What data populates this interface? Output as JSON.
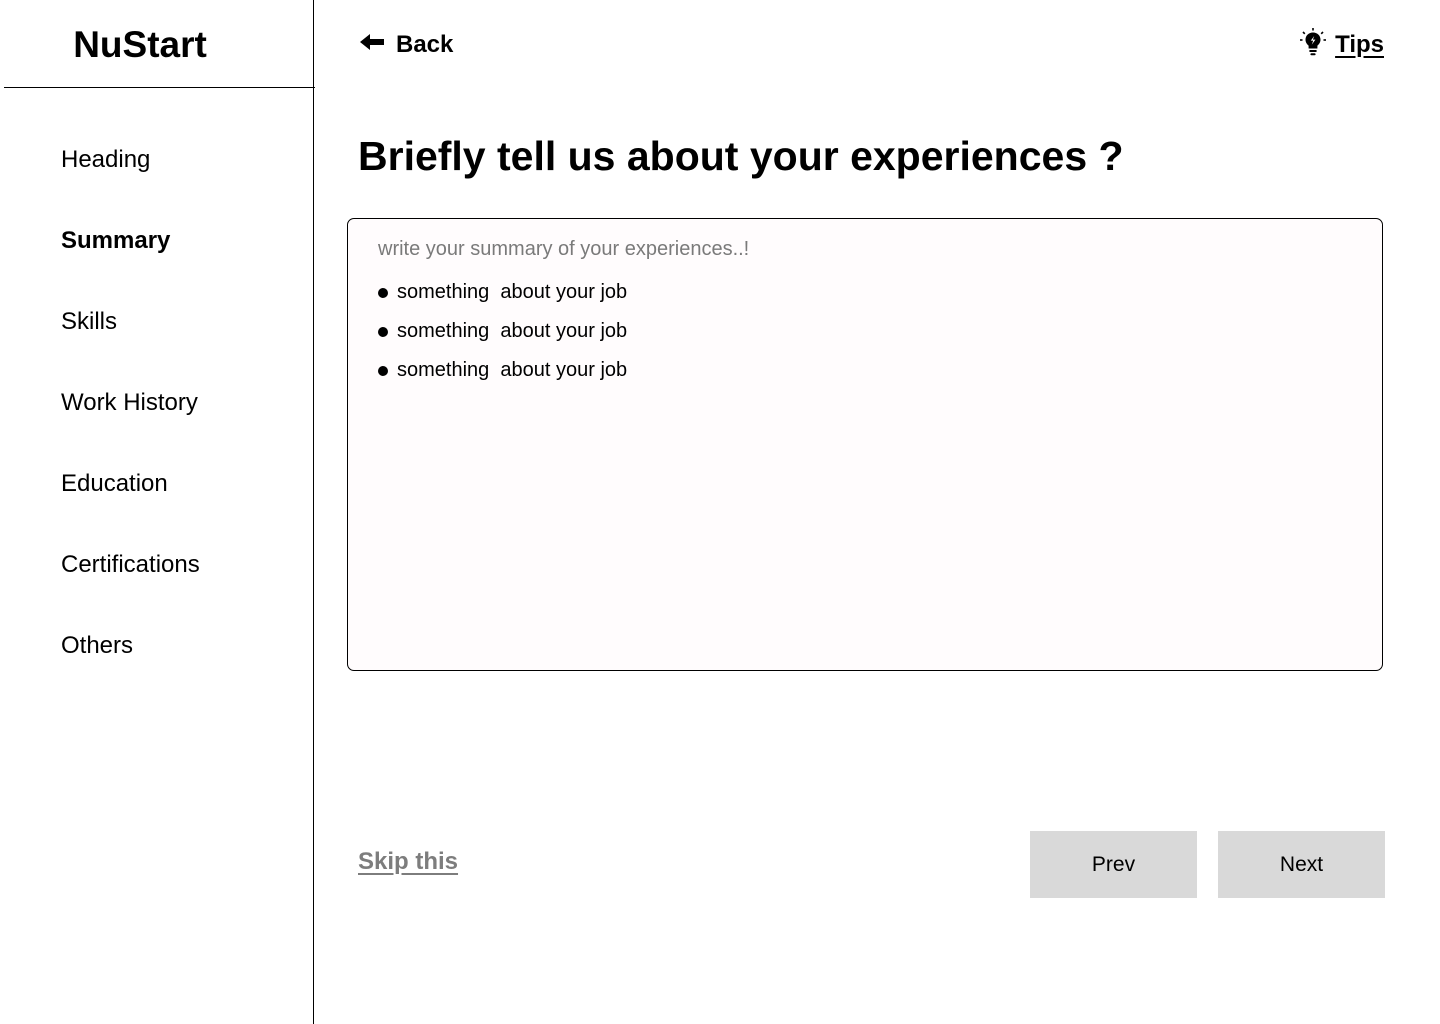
{
  "app": {
    "logo": "NuStart"
  },
  "sidebar": {
    "items": [
      {
        "label": "Heading",
        "active": false
      },
      {
        "label": "Summary",
        "active": true
      },
      {
        "label": "Skills",
        "active": false
      },
      {
        "label": "Work History",
        "active": false
      },
      {
        "label": "Education",
        "active": false
      },
      {
        "label": "Certifications",
        "active": false
      },
      {
        "label": "Others",
        "active": false
      }
    ]
  },
  "header": {
    "back_label": "Back",
    "back_icon": "arrow-left-icon",
    "tips_label": "Tips",
    "tips_icon": "lightbulb-icon"
  },
  "main": {
    "title": "Briefly tell us about your experiences ?",
    "summary": {
      "placeholder": "write your summary of your experiences..!",
      "bullets": [
        "something  about your job",
        "something  about your job",
        "something  about your job"
      ]
    }
  },
  "footer": {
    "skip_label": "Skip this",
    "prev_label": "Prev",
    "next_label": "Next"
  },
  "colors": {
    "text": "#000000",
    "muted": "#7d7d7d",
    "button_bg": "#d9d9d9",
    "box_bg": "#fffcfd"
  }
}
